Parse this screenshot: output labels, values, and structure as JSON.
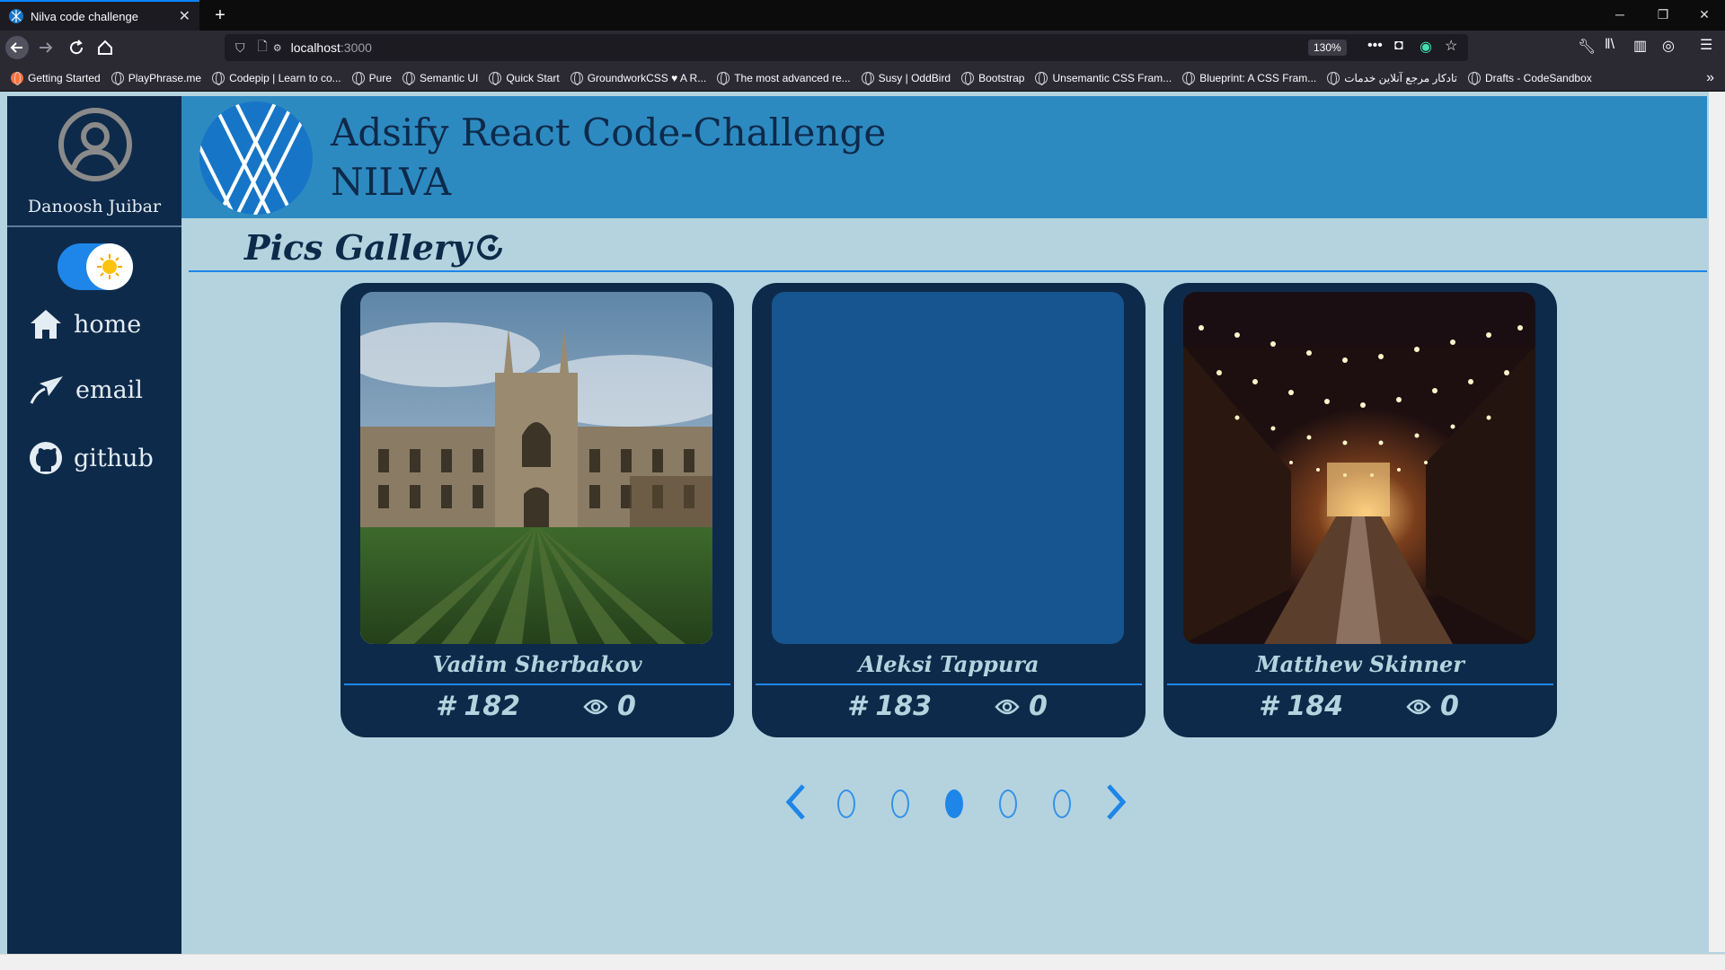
{
  "browser": {
    "tab_title": "Nilva code challenge",
    "url_host": "localhost",
    "url_port": ":3000",
    "zoom": "130%",
    "bookmarks": [
      "Getting Started",
      "PlayPhrase.me",
      "Codepip | Learn to co...",
      "Pure",
      "Semantic UI",
      "Quick Start",
      "GroundworkCSS ♥ A R...",
      "The most advanced re...",
      "Susy | OddBird",
      "Bootstrap",
      "Unsemantic CSS Fram...",
      "Blueprint: A CSS Fram...",
      "تادکار مرجع آنلاین خدمات",
      "Drafts - CodeSandbox"
    ]
  },
  "sidebar": {
    "user_name": "Danoosh Juibar",
    "nav": [
      {
        "label": "home",
        "icon": "home-icon"
      },
      {
        "label": "email",
        "icon": "paper-plane-icon"
      },
      {
        "label": "github",
        "icon": "github-icon"
      }
    ]
  },
  "header": {
    "title_line1": "Adsify React Code-Challenge",
    "title_line2": "NILVA"
  },
  "gallery": {
    "title": "Pics Gallery",
    "cards": [
      {
        "author": "Vadim Sherbakov",
        "id": "# 182",
        "views": "0",
        "image": "college-building"
      },
      {
        "author": "Aleksi Tappura",
        "id": "# 183",
        "views": "0",
        "image": "blank"
      },
      {
        "author": "Matthew Skinner",
        "id": "# 184",
        "views": "0",
        "image": "night-alley-lights"
      }
    ],
    "pager": {
      "pages": 5,
      "active_index": 2
    }
  },
  "colors": {
    "sidebar": "#0e2a4a",
    "header": "#2d8ac1",
    "background": "#b5d3df",
    "accent": "#1e86e8"
  }
}
